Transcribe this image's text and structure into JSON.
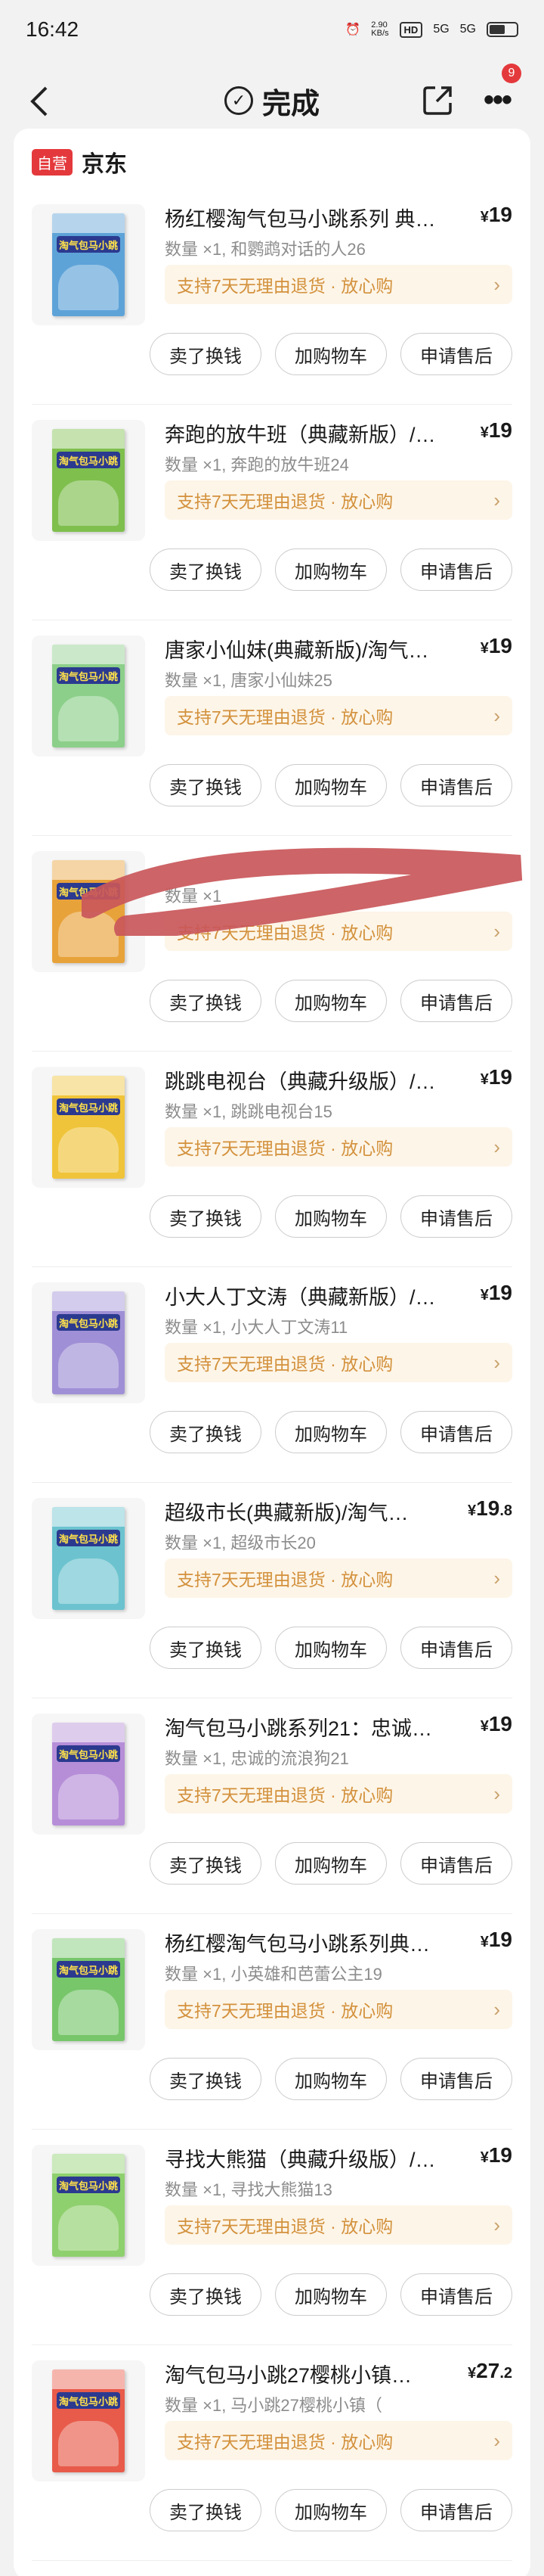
{
  "status": {
    "time": "16:42",
    "speed": "2.90\nKB/s",
    "net1": "HD",
    "net2": "5G",
    "net3": "5G"
  },
  "nav": {
    "title": "完成",
    "badge": "9"
  },
  "store": {
    "tag": "自营",
    "name": "京东"
  },
  "colors": {
    "accent": "#e4393c",
    "promise_text": "#d3913c",
    "promise_bg": "#fdf5e8"
  },
  "buttons": {
    "exchange": "卖了换钱",
    "cart": "加购物车",
    "after_sale": "申请售后"
  },
  "promise_text": "支持7天无理由退货 · 放心购",
  "items": [
    {
      "title": "杨红樱淘气包马小跳系列 典…",
      "price_int": "19",
      "price_dec": "",
      "qty": "数量 ×1, 和鹦鹉对话的人26",
      "cover": "#5ea3d8"
    },
    {
      "title": "奔跑的放牛班（典藏新版）/…",
      "price_int": "19",
      "price_dec": "",
      "qty": "数量 ×1, 奔跑的放牛班24",
      "cover": "#7fbf4e"
    },
    {
      "title": "唐家小仙妹(典藏新版)/淘气…",
      "price_int": "19",
      "price_dec": "",
      "qty": "数量 ×1, 唐家小仙妹25",
      "cover": "#8ccf8a"
    },
    {
      "title": "",
      "price_int": "",
      "price_dec": "",
      "qty": "数量 ×1",
      "cover": "#e8a23a"
    },
    {
      "title": "跳跳电视台（典藏升级版）/…",
      "price_int": "19",
      "price_dec": "",
      "qty": "数量 ×1, 跳跳电视台15",
      "cover": "#f0c43a"
    },
    {
      "title": "小大人丁文涛（典藏新版）/…",
      "price_int": "19",
      "price_dec": "",
      "qty": "数量 ×1, 小大人丁文涛11",
      "cover": "#9f8fd6"
    },
    {
      "title": "超级市长(典藏新版)/淘气…",
      "price_int": "19",
      "price_dec": ".8",
      "qty": "数量 ×1, 超级市长20",
      "cover": "#6cc3cf"
    },
    {
      "title": "淘气包马小跳系列21：忠诚…",
      "price_int": "19",
      "price_dec": "",
      "qty": "数量 ×1, 忠诚的流浪狗21",
      "cover": "#b68ed8"
    },
    {
      "title": "杨红樱淘气包马小跳系列典…",
      "price_int": "19",
      "price_dec": "",
      "qty": "数量 ×1, 小英雄和芭蕾公主19",
      "cover": "#77c66a"
    },
    {
      "title": "寻找大熊猫（典藏升级版）/…",
      "price_int": "19",
      "price_dec": "",
      "qty": "数量 ×1, 寻找大熊猫13",
      "cover": "#8fd06e"
    },
    {
      "title": "淘气包马小跳27樱桃小镇…",
      "price_int": "27",
      "price_dec": ".2",
      "qty": "数量 ×1, 马小跳27樱桃小镇（",
      "cover": "#e85b4a"
    }
  ]
}
